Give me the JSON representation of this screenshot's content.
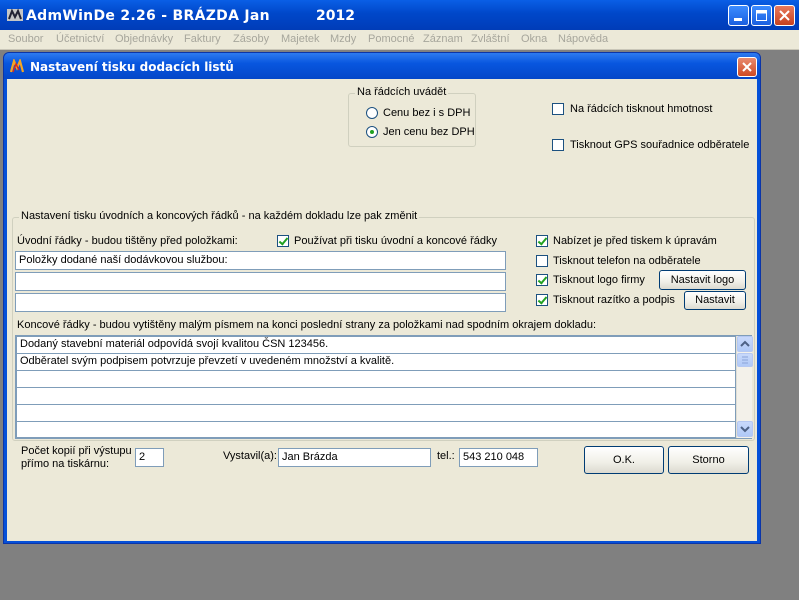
{
  "app": {
    "title": "AdmWinDe 2.26 - BRÁZDA Jan",
    "year": "2012",
    "menu": [
      "Soubor",
      "Účetnictví",
      "Objednávky",
      "Faktury",
      "Zásoby",
      "Majetek",
      "Mzdy",
      "Pomocné",
      "Záznam",
      "Zvláštní",
      "Okna",
      "Nápověda"
    ]
  },
  "dialog": {
    "title": "Nastavení tisku dodacích listů",
    "price_group": {
      "legend": "Na řádcích uvádět",
      "options": [
        {
          "label": "Cenu bez i s DPH",
          "selected": false
        },
        {
          "label": "Jen cenu bez DPH",
          "selected": true
        }
      ]
    },
    "weight_check": {
      "label": "Na řádcích tisknout hmotnost",
      "checked": false
    },
    "gps_check": {
      "label": "Tisknout GPS souřadnice odběratele",
      "checked": false
    },
    "header_group": {
      "legend": "Nastavení tisku úvodních a koncových řádků - na každém dokladu lze pak změnit",
      "intro_label": "Úvodní řádky - budou tištěny před položkami:",
      "use_check": {
        "label": "Používat při tisku úvodní a koncové řádky",
        "checked": true
      },
      "intro_lines": [
        "Položky dodané naší dodávkovou službou:",
        "",
        ""
      ],
      "offer_check": {
        "label": "Nabízet je před tiskem k úpravám",
        "checked": true
      },
      "phone_check": {
        "label": "Tisknout telefon na odběratele",
        "checked": false
      },
      "logo_check": {
        "label": "Tisknout logo firmy",
        "checked": true
      },
      "logo_button": "Nastavit logo",
      "stamp_check": {
        "label": "Tisknout razítko a podpis",
        "checked": true
      },
      "stamp_button": "Nastavit",
      "footer_label": "Koncové řádky - budou vytištěny malým písmem na konci poslední strany za položkami nad spodním okrajem dokladu:",
      "footer_lines": [
        "Dodaný stavební materiál odpovídá svojí kvalitou ČSN 123456.",
        "Odběratel svým podpisem potvrzuje převzetí v uvedeném množství a kvalitě.",
        "",
        "",
        "",
        ""
      ]
    },
    "copies_label_1": "Počet kopií při výstupu",
    "copies_label_2": "přímo na tiskárnu:",
    "copies_value": "2",
    "issued_label": "Vystavil(a):",
    "issued_value": "Jan Brázda",
    "tel_label": "tel.:",
    "tel_value": "543 210 048",
    "ok_button": "O.K.",
    "cancel_button": "Storno"
  },
  "colors": {
    "titlebar": "#0047c9",
    "face": "#ece9d8",
    "desktop": "#808080",
    "check_mark": "#21a121"
  }
}
